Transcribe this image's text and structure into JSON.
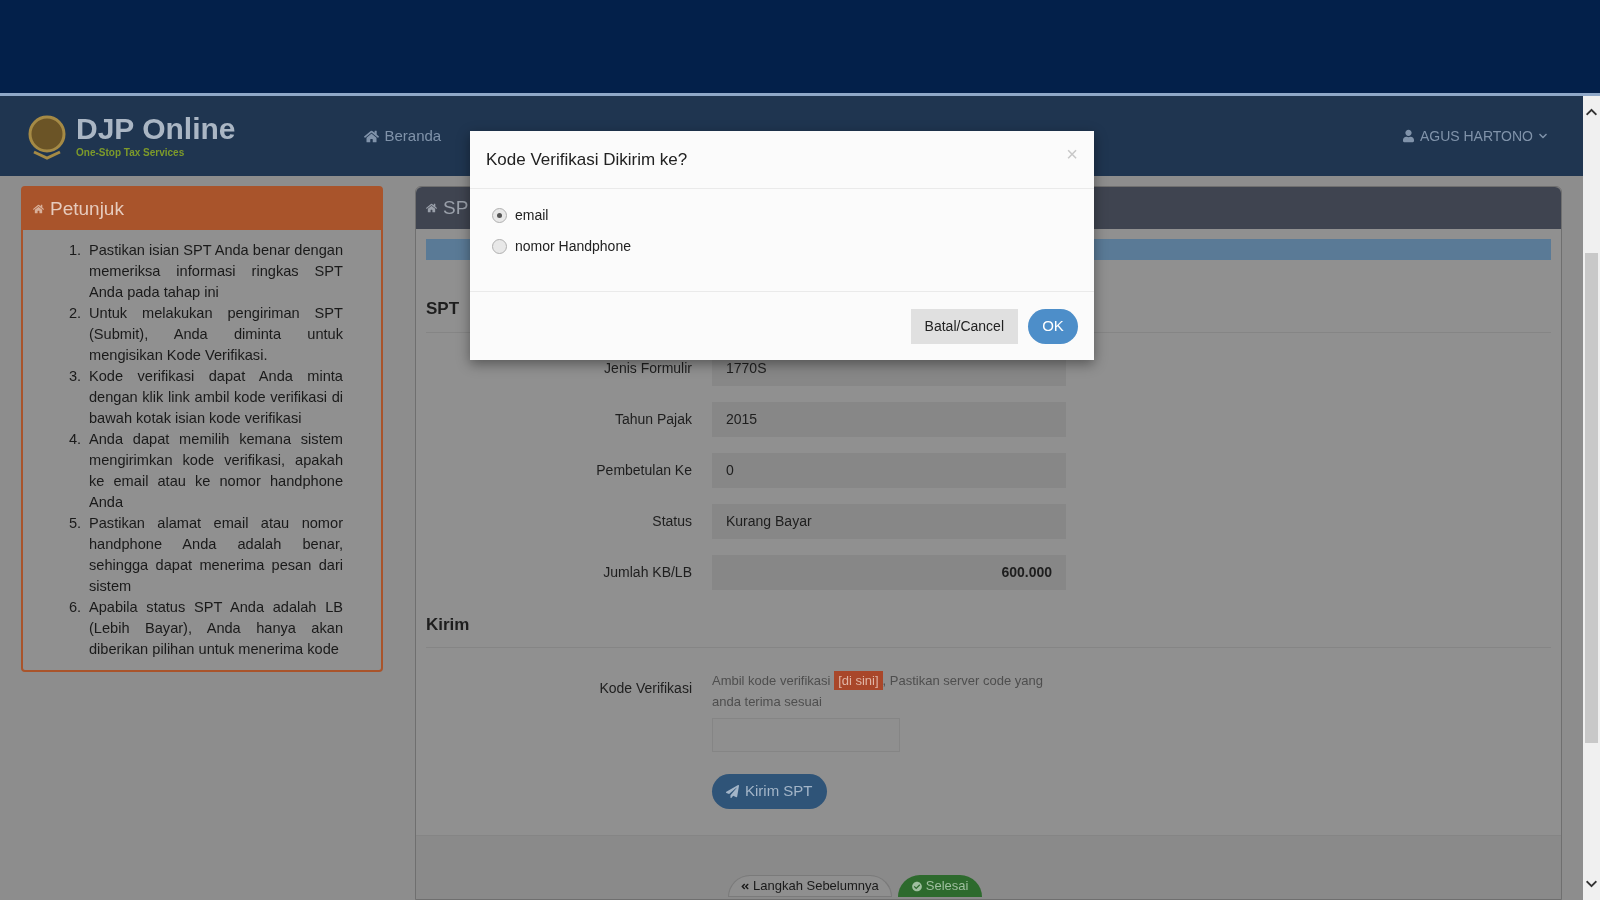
{
  "header": {
    "brand": "DJP Online",
    "tagline": "One-Stop Tax Services",
    "nav": [
      {
        "label": "Beranda"
      }
    ],
    "user": "AGUS HARTONO"
  },
  "instructions": {
    "title": "Petunjuk",
    "items": [
      {
        "number": "1.",
        "text": "Pastikan isian SPT Anda benar dengan memeriksa informasi ringkas SPT Anda pada tahap ini"
      },
      {
        "number": "2.",
        "text": "Untuk melakukan pengiriman SPT (Submit), Anda diminta untuk mengisikan Kode Verifikasi."
      },
      {
        "number": "3.",
        "text": "Kode verifikasi dapat Anda minta dengan klik link ambil kode verifikasi di bawah kotak isian kode verifikasi"
      },
      {
        "number": "4.",
        "text": "Anda dapat memilih kemana sistem mengirimkan kode verifikasi, apakah ke email atau ke nomor handphone Anda"
      },
      {
        "number": "5.",
        "text": "Pastikan alamat email atau nomor handphone Anda adalah benar, sehingga dapat menerima pesan dari sistem"
      },
      {
        "number": "6.",
        "text": "Apabila status SPT Anda adalah LB (Lebih Bayar), Anda hanya akan diberikan pilihan untuk menerima kode"
      }
    ]
  },
  "main": {
    "title": "SP",
    "progress": {
      "level": 1
    },
    "summary_heading": "SPT",
    "fields": [
      {
        "label": "Jenis Formulir",
        "value": "1770S",
        "kind": "text"
      },
      {
        "label": "Tahun Pajak",
        "value": "2015",
        "kind": "text"
      },
      {
        "label": "Pembetulan Ke",
        "value": "0",
        "kind": "text"
      },
      {
        "label": "Status",
        "value": "Kurang Bayar",
        "kind": "text"
      },
      {
        "label": "Jumlah KB/LB",
        "value": "600.000",
        "kind": "amount"
      }
    ],
    "send_heading": "Kirim",
    "code_label": "Kode Verifikasi",
    "hint_before": "Ambil kode verifikasi",
    "hint_link": "[di sini]",
    "hint_after": ", Pastikan server code yang anda terima sesuai",
    "send_button": "Kirim SPT",
    "prev_button": "Langkah Sebelumnya",
    "finish_button": "Selesai"
  },
  "modal": {
    "title": "Kode Verifikasi Dikirim ke?",
    "close": "×",
    "options": [
      {
        "label": "email",
        "selected": true
      },
      {
        "label": "nomor Handphone",
        "selected": false
      }
    ],
    "cancel": "Batal/Cancel",
    "ok": "OK"
  }
}
